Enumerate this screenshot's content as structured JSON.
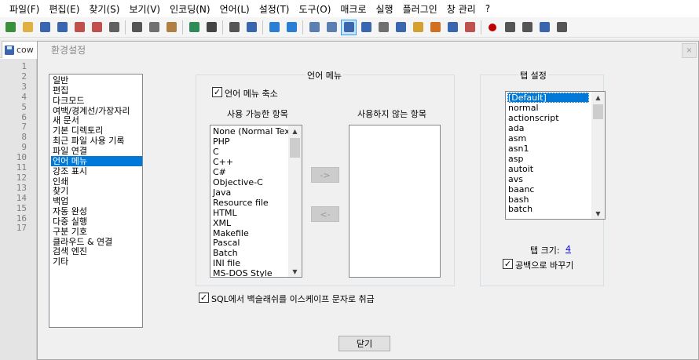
{
  "menu": [
    "파일(F)",
    "편집(E)",
    "찾기(S)",
    "보기(V)",
    "인코딩(N)",
    "언어(L)",
    "설정(T)",
    "도구(O)",
    "매크로",
    "실행",
    "플러그인",
    "창 관리",
    "?"
  ],
  "toolbar_icons": [
    "new-file-icon",
    "open-folder-icon",
    "save-icon",
    "save-all-icon",
    "close-icon",
    "close-all-icon",
    "print-icon",
    "cut-icon",
    "copy-icon",
    "paste-icon",
    "undo-icon",
    "redo-icon",
    "find-icon",
    "replace-icon",
    "zoom-in-icon",
    "zoom-out-icon",
    "sync-vertical-icon",
    "sync-horizontal-icon",
    "word-wrap-icon",
    "show-all-characters-icon",
    "indent-guide-icon",
    "language-icon",
    "folder-as-workspace-icon",
    "document-map-icon",
    "function-list-icon",
    "monitoring-icon",
    "start-recording-icon",
    "stop-recording-icon",
    "playback-icon",
    "run-macro-multiple-icon",
    "save-macro-icon"
  ],
  "tab": {
    "label": "cow"
  },
  "line_numbers": [
    "1",
    "2",
    "3",
    "4",
    "5",
    "6",
    "7",
    "8",
    "9",
    "10",
    "11",
    "12",
    "13",
    "14",
    "15",
    "16",
    "17"
  ],
  "dialog": {
    "title": "환경설정",
    "close_label": "×",
    "categories": [
      "일반",
      "편집",
      "다크모드",
      "여백/경계선/가장자리",
      "새 문서",
      "기본 디렉토리",
      "최근 파일 사용 기록",
      "파일 연결",
      "언어 메뉴",
      "강조 표시",
      "인쇄",
      "찾기",
      "백업",
      "자동 완성",
      "다중 실행",
      "구분 기호",
      "클라우드 & 연결",
      "검색 엔진",
      "기타"
    ],
    "selected_category": "언어 메뉴",
    "language_menu": {
      "group_title": "언어 메뉴",
      "compact_label": "언어 메뉴 축소",
      "compact_checked": true,
      "available_header": "사용 가능한 항목",
      "disabled_header": "사용하지 않는 항목",
      "available_items": [
        "None (Normal Text)",
        "PHP",
        "C",
        "C++",
        "C#",
        "Objective-C",
        "Java",
        "Resource file",
        "HTML",
        "XML",
        "Makefile",
        "Pascal",
        "Batch",
        "INI file",
        "MS-DOS Style"
      ],
      "disabled_items": [],
      "move_right_label": "->",
      "move_left_label": "<-"
    },
    "tab_settings": {
      "group_title": "탭 설정",
      "items": [
        "[Default]",
        "normal",
        "actionscript",
        "ada",
        "asm",
        "asn1",
        "asp",
        "autoit",
        "avs",
        "baanc",
        "bash",
        "batch"
      ],
      "selected_item": "[Default]",
      "tab_size_label": "탭 크기:",
      "tab_size_value": "4",
      "replace_by_space_label": "공백으로 바꾸기",
      "replace_by_space_checked": true
    },
    "sql_escape_label": "SQL에서 백슬래쉬를 이스케이프 문자로 취급",
    "sql_escape_checked": true,
    "close_button": "닫기"
  }
}
